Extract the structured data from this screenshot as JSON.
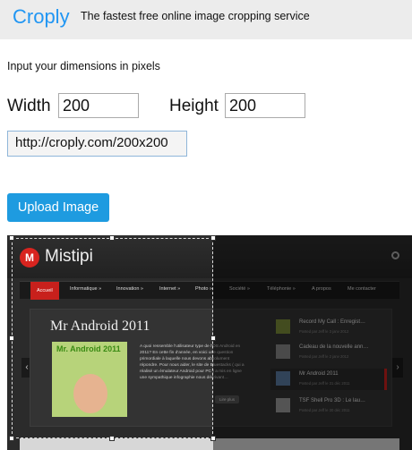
{
  "header": {
    "logo": "Croply",
    "tagline": "The fastest free online image cropping service"
  },
  "form": {
    "instruction": "Input your dimensions in pixels",
    "width_label": "Width",
    "width_value": "200",
    "height_label": "Height",
    "height_value": "200",
    "url": "http://croply.com/200x200",
    "upload_label": "Upload Image"
  },
  "preview": {
    "site_name": "Mistipi",
    "logo_letter": "M",
    "nav": [
      "Accueil",
      "Informatique »",
      "Innovation »",
      "Internet »",
      "Photo »",
      "Société »",
      "Téléphonie »",
      "A propos",
      "Me contacter"
    ],
    "post_title": "Mr Android 2011",
    "thumb_title": "Mr. Android 2011",
    "post_desc": "A quoi ressemble l'utilisateur type de l'OS Android en 2011? En cette fin d'année, en voici une question primordiale à laquelle nous devons absolument répondre. Pour nous aider, le site de Bluestacks ( qui a réalisé un émulateur Android pour PC ) a mis en ligne une sympathique infographie nous décrivant…",
    "read_more": "Lire plus",
    "sidebar": [
      {
        "title": "Record My Call : Enregist…",
        "meta": "Posted par Jeff le 3 janv 2012"
      },
      {
        "title": "Cadeau de la nouvelle ann…",
        "meta": "Posted par Jeff le 2 janv 2012"
      },
      {
        "title": "Mr Android 2011",
        "meta": "Posted par Jeff le 31 déc 2011"
      },
      {
        "title": "TSF Shell Pro 3D : Le lau…",
        "meta": "Posted par Jeff le 30 déc 2011"
      }
    ]
  }
}
